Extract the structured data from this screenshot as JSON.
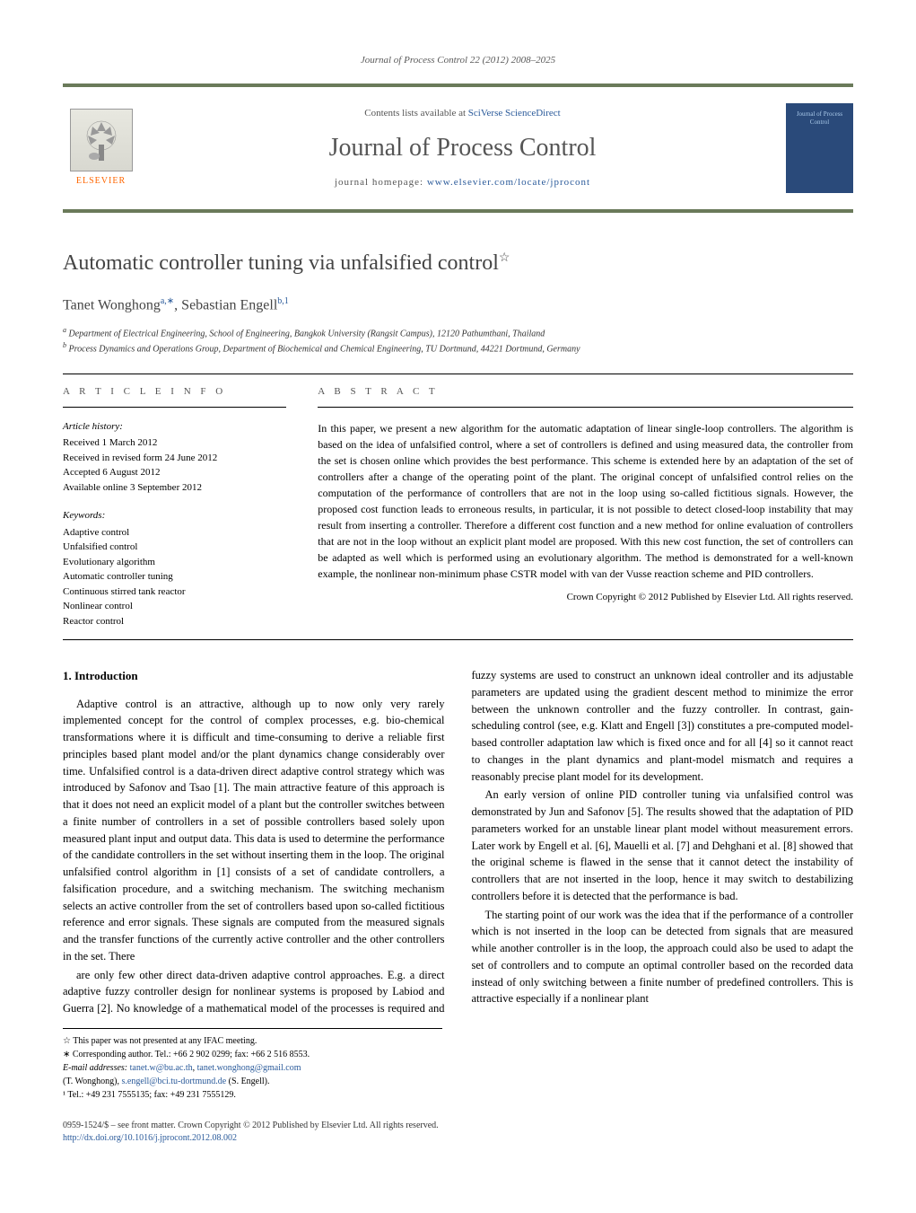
{
  "header": {
    "journal_ref": "Journal of Process Control 22 (2012) 2008–2025",
    "contents_prefix": "Contents lists available at ",
    "contents_link": "SciVerse ScienceDirect",
    "journal_title": "Journal of Process Control",
    "homepage_prefix": "journal homepage: ",
    "homepage_url": "www.elsevier.com/locate/jprocont",
    "elsevier_text": "ELSEVIER",
    "cover_text": "Journal of Process Control"
  },
  "article": {
    "title": "Automatic controller tuning via unfalsified control",
    "title_sup": "☆",
    "authors_html": "Tanet Wonghong",
    "author1_sup": "a,∗",
    "author2": ", Sebastian Engell",
    "author2_sup": "b,1",
    "affil_a_sup": "a",
    "affil_a": " Department of Electrical Engineering, School of Engineering, Bangkok University (Rangsit Campus), 12120 Pathumthani, Thailand",
    "affil_b_sup": "b",
    "affil_b": " Process Dynamics and Operations Group, Department of Biochemical and Chemical Engineering, TU Dortmund, 44221 Dortmund, Germany"
  },
  "info": {
    "heading": "a r t i c l e   i n f o",
    "history_label": "Article history:",
    "history_text": "Received 1 March 2012\nReceived in revised form 24 June 2012\nAccepted 6 August 2012\nAvailable online 3 September 2012",
    "keywords_label": "Keywords:",
    "keywords_text": "Adaptive control\nUnfalsified control\nEvolutionary algorithm\nAutomatic controller tuning\nContinuous stirred tank reactor\nNonlinear control\nReactor control"
  },
  "abstract": {
    "heading": "a b s t r a c t",
    "text": "In this paper, we present a new algorithm for the automatic adaptation of linear single-loop controllers. The algorithm is based on the idea of unfalsified control, where a set of controllers is defined and using measured data, the controller from the set is chosen online which provides the best performance. This scheme is extended here by an adaptation of the set of controllers after a change of the operating point of the plant. The original concept of unfalsified control relies on the computation of the performance of controllers that are not in the loop using so-called fictitious signals. However, the proposed cost function leads to erroneous results, in particular, it is not possible to detect closed-loop instability that may result from inserting a controller. Therefore a different cost function and a new method for online evaluation of controllers that are not in the loop without an explicit plant model are proposed. With this new cost function, the set of controllers can be adapted as well which is performed using an evolutionary algorithm. The method is demonstrated for a well-known example, the nonlinear non-minimum phase CSTR model with van der Vusse reaction scheme and PID controllers.",
    "copyright": "Crown Copyright © 2012 Published by Elsevier Ltd. All rights reserved."
  },
  "body": {
    "section1_title": "1. Introduction",
    "p1": "Adaptive control is an attractive, although up to now only very rarely implemented concept for the control of complex processes, e.g. bio-chemical transformations where it is difficult and time-consuming to derive a reliable first principles based plant model and/or the plant dynamics change considerably over time. Unfalsified control is a data-driven direct adaptive control strategy which was introduced by Safonov and Tsao [1]. The main attractive feature of this approach is that it does not need an explicit model of a plant but the controller switches between a finite number of controllers in a set of possible controllers based solely upon measured plant input and output data. This data is used to determine the performance of the candidate controllers in the set without inserting them in the loop. The original unfalsified control algorithm in [1] consists of a set of candidate controllers, a falsification procedure, and a switching mechanism. The switching mechanism selects an active controller from the set of controllers based upon so-called fictitious reference and error signals. These signals are computed from the measured signals and the transfer functions of the currently active controller and the other controllers in the set. There",
    "p2": "are only few other direct data-driven adaptive control approaches. E.g. a direct adaptive fuzzy controller design for nonlinear systems is proposed by Labiod and Guerra [2]. No knowledge of a mathematical model of the processes is required and fuzzy systems are used to construct an unknown ideal controller and its adjustable parameters are updated using the gradient descent method to minimize the error between the unknown controller and the fuzzy controller. In contrast, gain-scheduling control (see, e.g. Klatt and Engell [3]) constitutes a pre-computed model-based controller adaptation law which is fixed once and for all [4] so it cannot react to changes in the plant dynamics and plant-model mismatch and requires a reasonably precise plant model for its development.",
    "p3": "An early version of online PID controller tuning via unfalsified control was demonstrated by Jun and Safonov [5]. The results showed that the adaptation of PID parameters worked for an unstable linear plant model without measurement errors. Later work by Engell et al. [6], Mauelli et al. [7] and Dehghani et al. [8] showed that the original scheme is flawed in the sense that it cannot detect the instability of controllers that are not inserted in the loop, hence it may switch to destabilizing controllers before it is detected that the performance is bad.",
    "p4": "The starting point of our work was the idea that if the performance of a controller which is not inserted in the loop can be detected from signals that are measured while another controller is in the loop, the approach could also be used to adapt the set of controllers and to compute an optimal controller based on the recorded data instead of only switching between a finite number of predefined controllers. This is attractive especially if a nonlinear plant"
  },
  "footnotes": {
    "star": "☆ This paper was not presented at any IFAC meeting.",
    "corr": "∗ Corresponding author. Tel.: +66 2 902 0299; fax: +66 2 516 8553.",
    "email_label": "E-mail addresses: ",
    "email1": "tanet.w@bu.ac.th",
    "email1_sep": ", ",
    "email2": "tanet.wonghong@gmail.com",
    "email_author1": "(T. Wonghong), ",
    "email3": "s.engell@bci.tu-dortmund.de",
    "email_author2": " (S. Engell).",
    "tel1": "¹ Tel.: +49 231 7555135; fax: +49 231 7555129."
  },
  "footer": {
    "line1": "0959-1524/$ – see front matter. Crown Copyright © 2012 Published by Elsevier Ltd. All rights reserved.",
    "doi": "http://dx.doi.org/10.1016/j.jprocont.2012.08.002"
  }
}
